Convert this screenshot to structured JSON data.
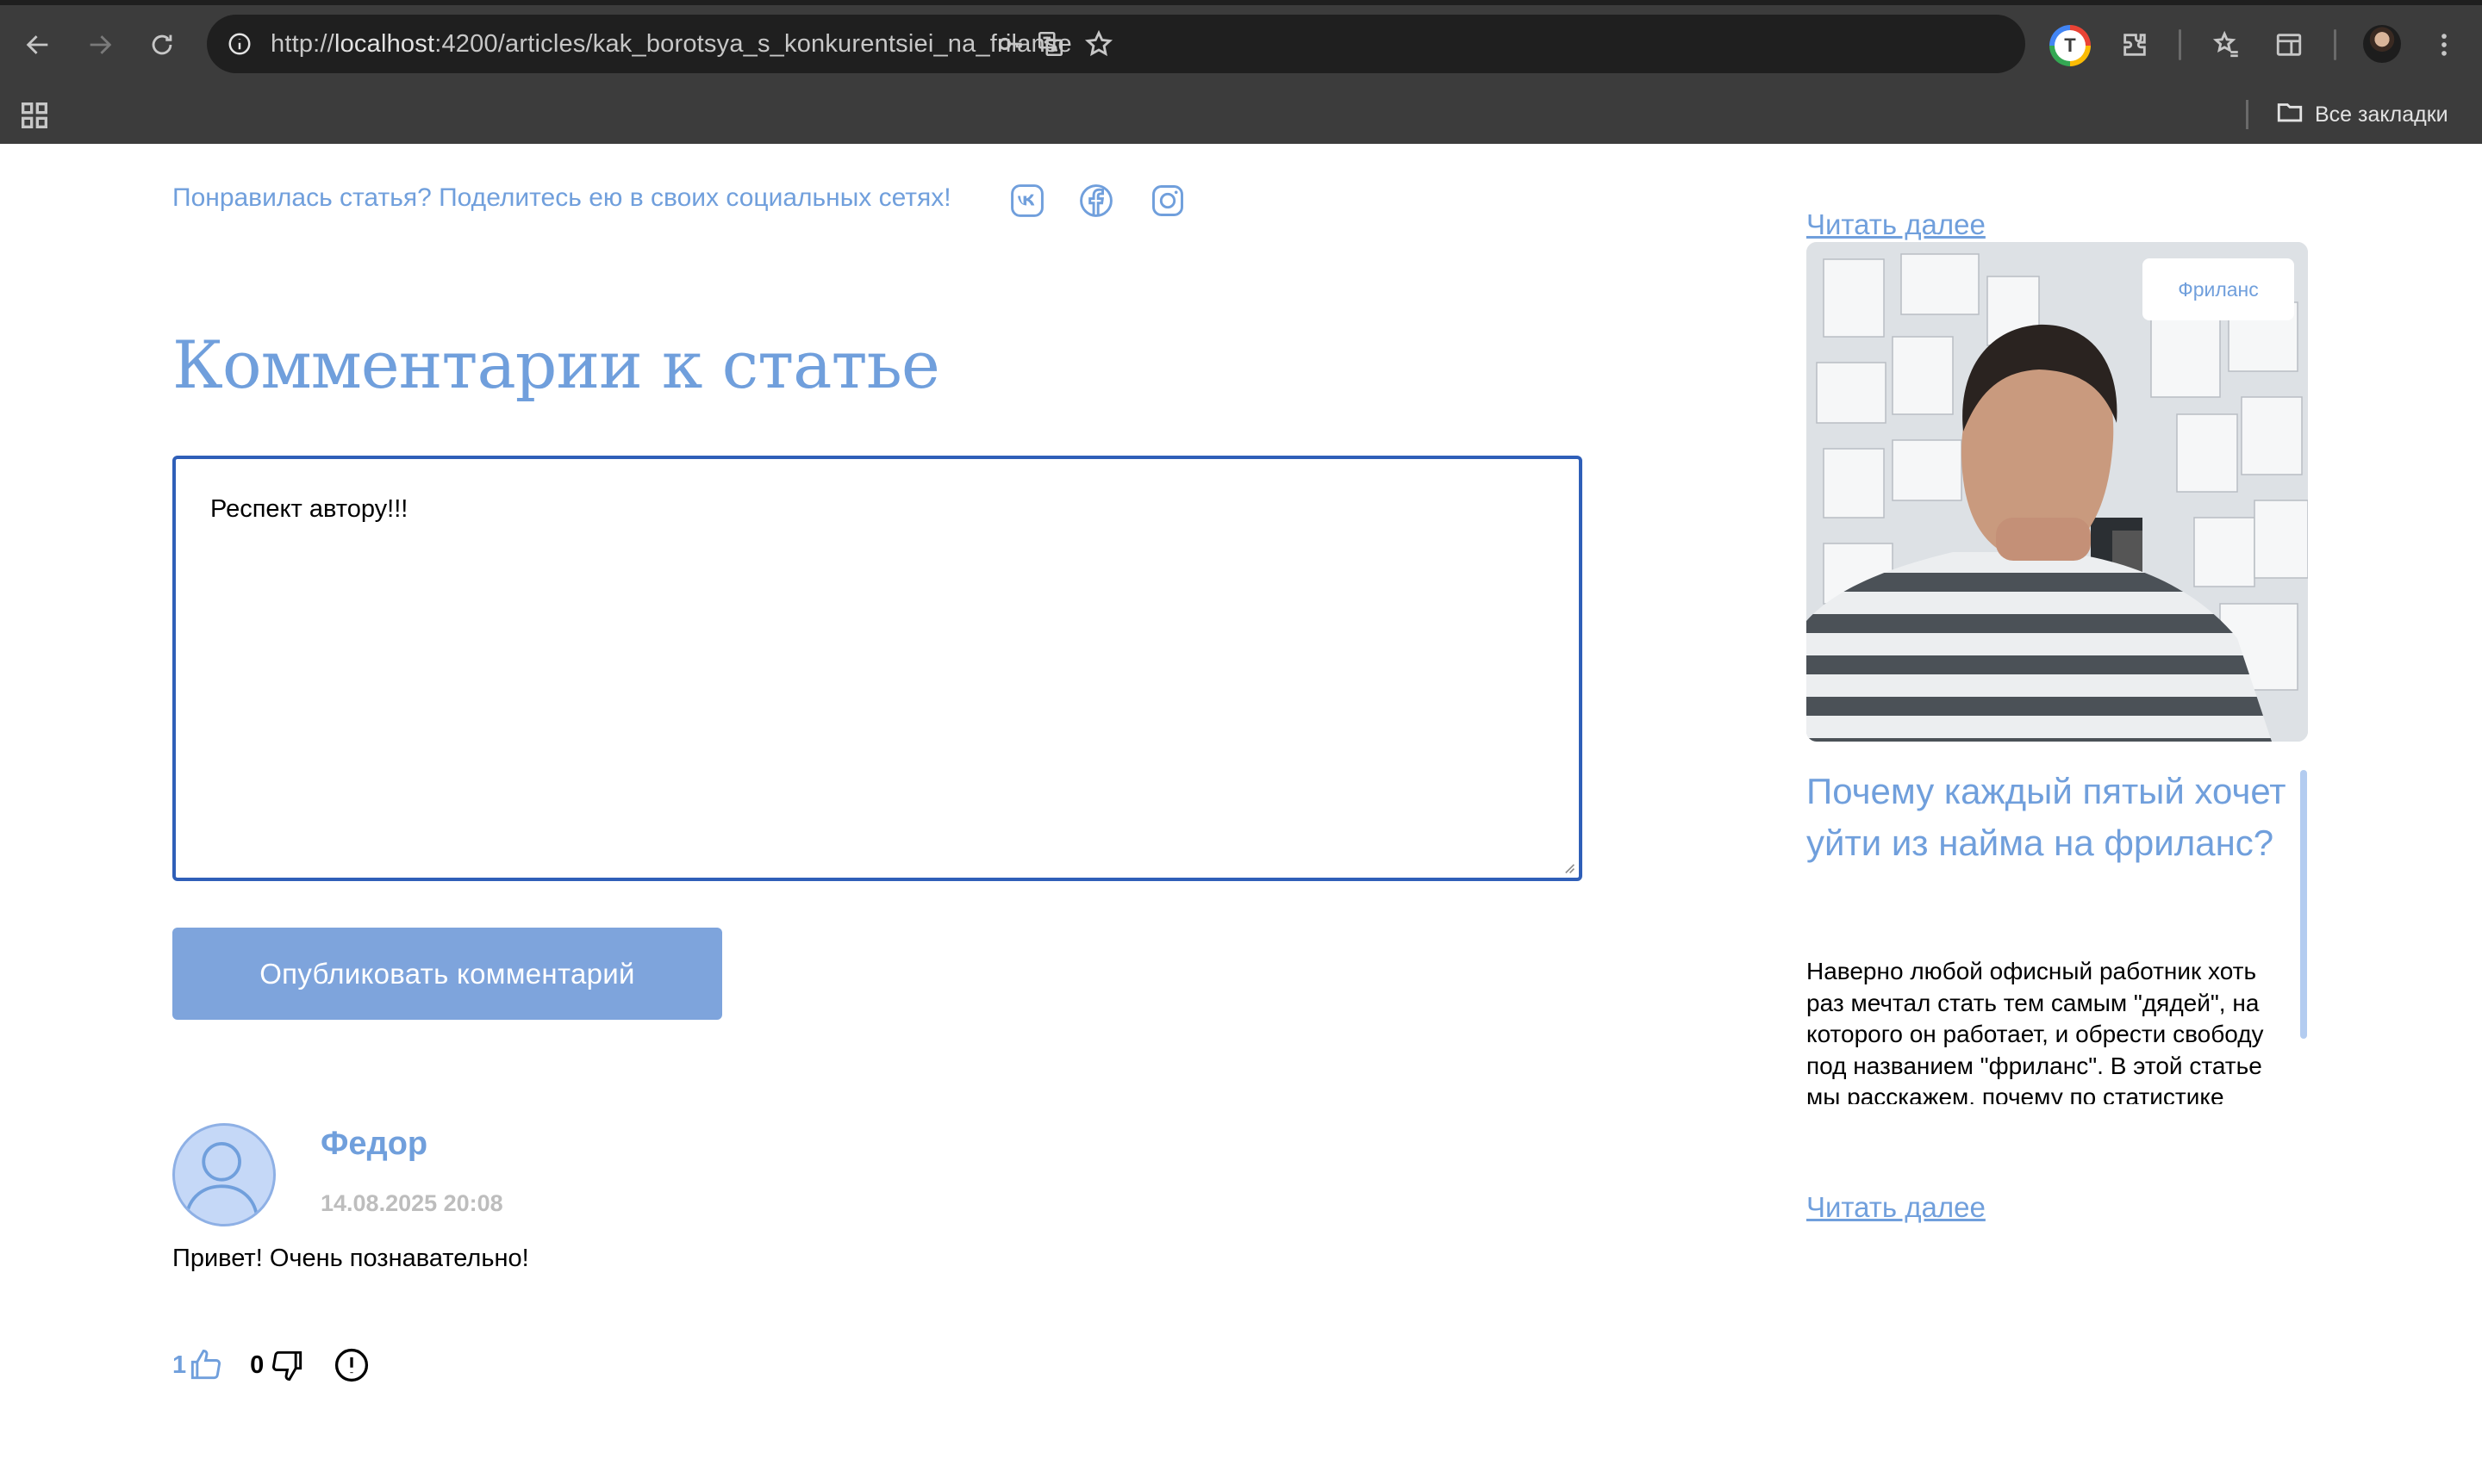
{
  "browser": {
    "url_scheme": "http://",
    "url_host": "localhost",
    "url_rest": ":4200/articles/kak_borotsya_s_konkurentsiei_na_frilanse",
    "profile_letter": "T",
    "bookmarks_all": "Все закладки",
    "icons": [
      "back-icon",
      "forward-icon",
      "reload-icon",
      "site-info-icon",
      "password-key-icon",
      "translate-icon",
      "bookmark-star-icon",
      "extensions-icon",
      "reading-list-icon",
      "side-panel-icon",
      "menu-icon",
      "apps-icon",
      "folder-icon"
    ]
  },
  "share": {
    "text": "Понравилась статья? Поделитесь ею в своих социальных сетях!",
    "networks": [
      "vk-icon",
      "facebook-icon",
      "instagram-icon"
    ]
  },
  "comments": {
    "title": "Комментарии к статье",
    "draft": "Респект автору!!!",
    "publish_label": "Опубликовать комментарий",
    "items": [
      {
        "author": "Федор",
        "date": "14.08.2025 20:08",
        "text": "Привет! Очень познавательно!",
        "likes": "1",
        "dislikes": "0"
      }
    ]
  },
  "sidebar": {
    "read_more_top": "Читать далее",
    "card": {
      "tag": "Фриланс",
      "title": "Почему каждый пятый хочет уйти из найма на фриланс?",
      "description": "Наверно любой офисный работник хоть раз мечтал стать тем самым \"дядей\", на которого он работает, и обрести свободу под названием \"фриланс\". В этой статье мы расскажем, почему по статистике каждый пятый сотрудник хочет уйти",
      "read_more": "Читать далее"
    }
  },
  "colors": {
    "accent": "#709FDC",
    "button": "#7EA4DC",
    "focus_border": "#2F5FB8",
    "chrome_bg": "#3C3C3C"
  }
}
